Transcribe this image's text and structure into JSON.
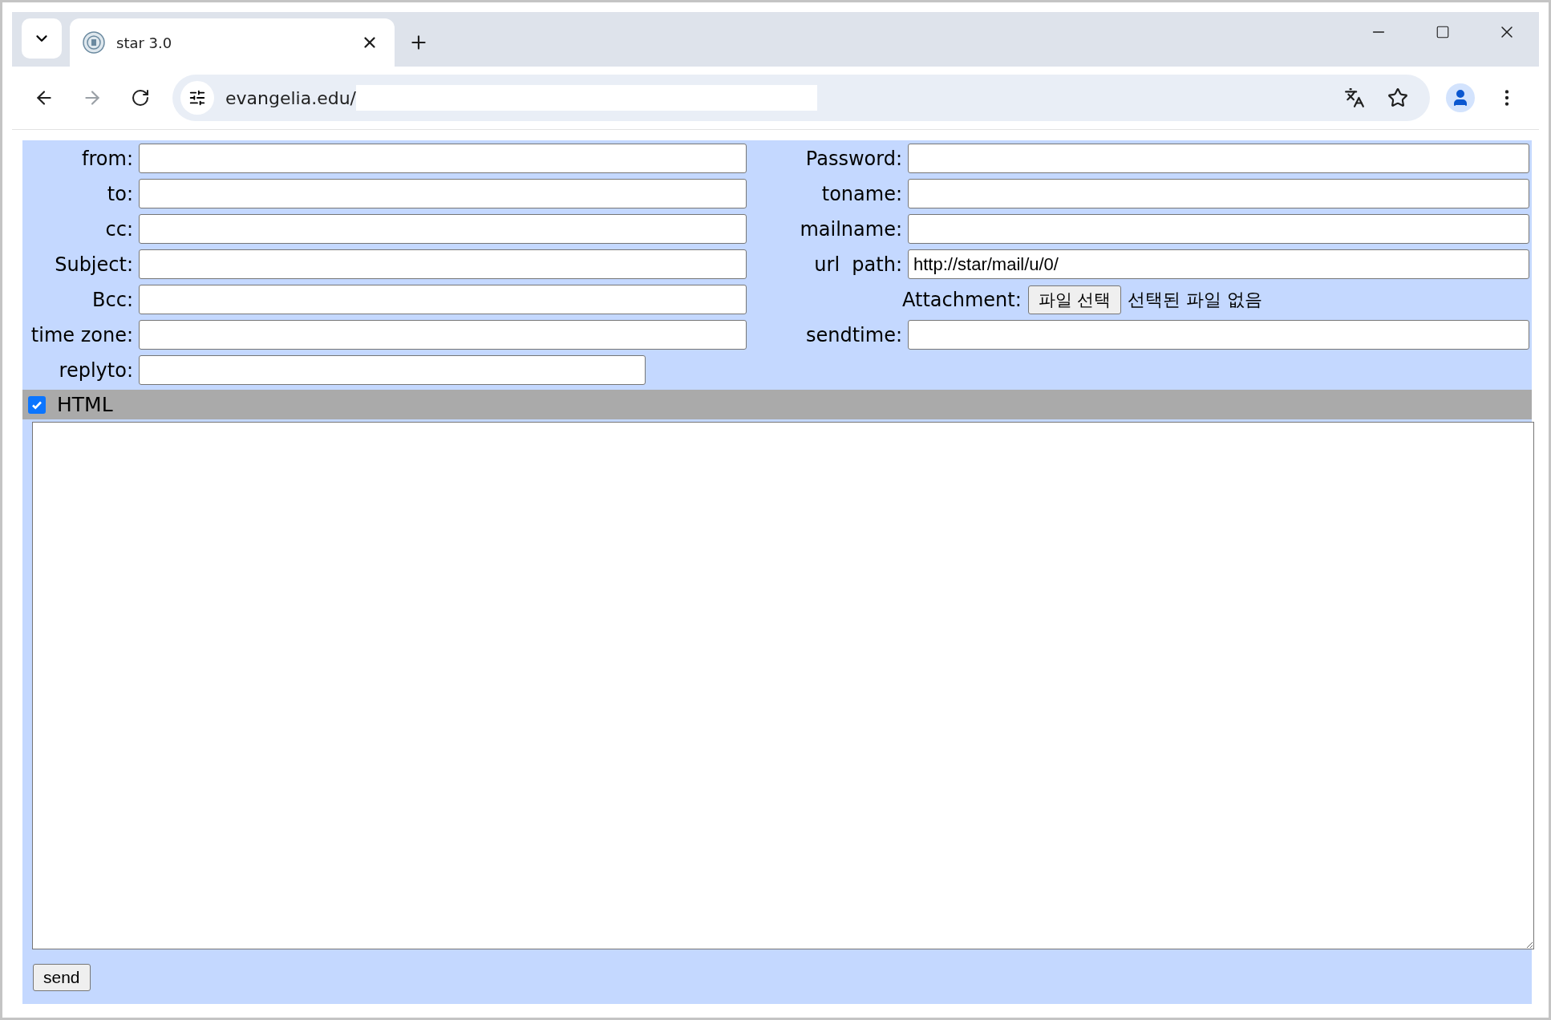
{
  "browser": {
    "tab_title": "star 3.0",
    "url": "evangelia.edu/"
  },
  "form": {
    "rows": [
      {
        "left": {
          "label": "from:"
        },
        "right": {
          "kind": "text",
          "label": "Password:"
        }
      },
      {
        "left": {
          "label": "to:"
        },
        "right": {
          "kind": "text",
          "label": "toname:"
        }
      },
      {
        "left": {
          "label": "cc:"
        },
        "right": {
          "kind": "text",
          "label": "mailname:"
        }
      },
      {
        "left": {
          "label": "Subject:"
        },
        "right": {
          "kind": "text",
          "label": "url  path:",
          "value": "http://star/mail/u/0/"
        }
      },
      {
        "left": {
          "label": "Bcc:"
        },
        "right": {
          "kind": "file",
          "label": "Attachment:",
          "button": "파일 선택",
          "status": "선택된 파일 없음"
        }
      },
      {
        "left": {
          "label": "time zone:"
        },
        "right": {
          "kind": "text",
          "label": "sendtime:"
        }
      },
      {
        "left": {
          "label": "replyto:"
        }
      }
    ],
    "html_toggle": {
      "label": "HTML",
      "checked": true
    },
    "send_button": "send"
  }
}
